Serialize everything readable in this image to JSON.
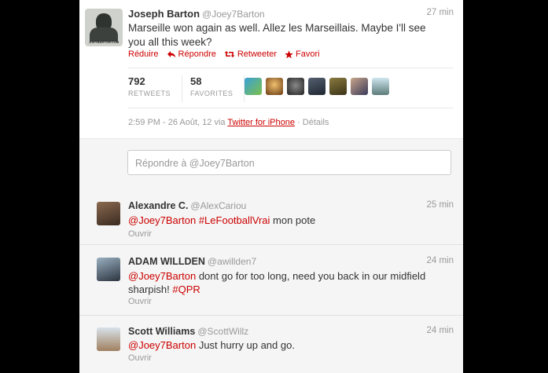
{
  "main_tweet": {
    "name": "Joseph Barton",
    "handle": "@Joey7Barton",
    "time": "27 min",
    "text": "Marseille won again as well. Allez les Marseillais. Maybe I'll see you all this week?",
    "avatar_site_text": "JOEYBARTON.COM",
    "actions": {
      "reply": "Réduire",
      "respond": "Répondre",
      "retweet": "Retweeter",
      "favorite": "Favori"
    },
    "stats": {
      "retweets_count": "792",
      "retweets_label": "RETWEETS",
      "favorites_count": "58",
      "favorites_label": "FAVORITES"
    },
    "meta": {
      "timestamp": "2:59 PM - 26 Août, 12 via ",
      "via": "Twitter for iPhone",
      "details": " · Détails"
    }
  },
  "reply_box": {
    "placeholder": "Répondre à @Joey7Barton"
  },
  "replies": [
    {
      "name": "Alexandre C.",
      "handle": "@AlexCariou",
      "time": "25 min",
      "mention": "@Joey7Barton",
      "hashtag": "#LeFootballVrai",
      "text_rest": " mon pote",
      "open_label": "Ouvrir"
    },
    {
      "name": "ADAM WILLDEN",
      "handle": "@awillden7",
      "time": "24 min",
      "mention": "@Joey7Barton",
      "text_rest": " dont go for too long, need you back in our midfield sharpish! ",
      "hashtag": "#QPR",
      "open_label": "Ouvrir"
    },
    {
      "name": "Scott Williams",
      "handle": "@ScottWillz",
      "time": "24 min",
      "mention": "@Joey7Barton",
      "text_rest": " Just hurry up and go.",
      "open_label": "Ouvrir"
    }
  ],
  "colors": {
    "accent": "#cc0000",
    "muted": "#999999",
    "background": "#000000"
  }
}
